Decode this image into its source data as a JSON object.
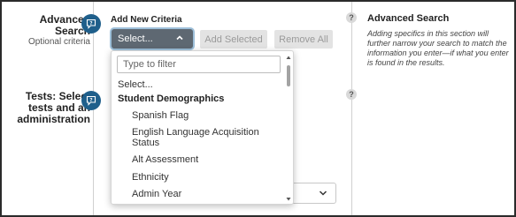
{
  "sections": {
    "advanced": {
      "title_line1": "Advanced",
      "title_line2": "Search",
      "subtitle": "Optional criteria"
    },
    "tests": {
      "line1": "Tests: Select",
      "line2": "tests and an",
      "line3": "administration"
    }
  },
  "criteria": {
    "label": "Add New Criteria",
    "select_label": "Select...",
    "add_selected_label": "Add Selected",
    "remove_all_label": "Remove All"
  },
  "dropdown": {
    "filter_placeholder": "Type to filter",
    "options": {
      "select": "Select...",
      "group": "Student Demographics",
      "item1": "Spanish Flag",
      "item2_line1": "English Language Acquisition",
      "item2_line2": "Status",
      "item3": "Alt Assessment",
      "item4": "Ethnicity",
      "item5": "Admin Year"
    }
  },
  "help_panel": {
    "icon_glyph": "?",
    "title": "Advanced Search",
    "body": "Adding specifics in this section will further narrow your search to match the information you enter—if what you enter is found in the results."
  },
  "colors": {
    "badge": "#1f5f8b",
    "select_button": "#5e6872",
    "disabled_button": "#e3e3e3"
  },
  "icons": [
    "help-chat-icon",
    "chevron-up-icon",
    "chevron-down-icon",
    "question-icon"
  ]
}
